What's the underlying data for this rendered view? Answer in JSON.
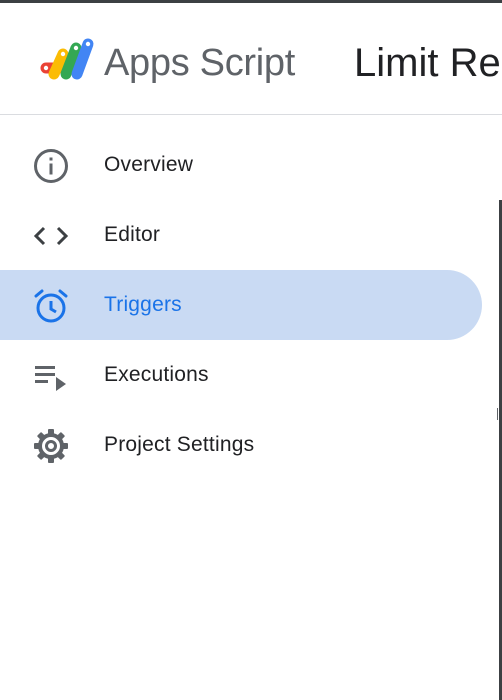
{
  "header": {
    "app_name": "Apps Script",
    "project_title": "Limit Re"
  },
  "nav": {
    "items": [
      {
        "label": "Overview",
        "icon": "info-icon",
        "active": false
      },
      {
        "label": "Editor",
        "icon": "code-icon",
        "active": false
      },
      {
        "label": "Triggers",
        "icon": "alarm-clock-icon",
        "active": true
      },
      {
        "label": "Executions",
        "icon": "executions-list-icon",
        "active": false
      },
      {
        "label": "Project Settings",
        "icon": "gear-icon",
        "active": false
      }
    ]
  },
  "colors": {
    "active_bg": "#c9daf3",
    "active_text": "#1a73e8",
    "icon_gray": "#5f6368",
    "text_dark": "#202124"
  }
}
